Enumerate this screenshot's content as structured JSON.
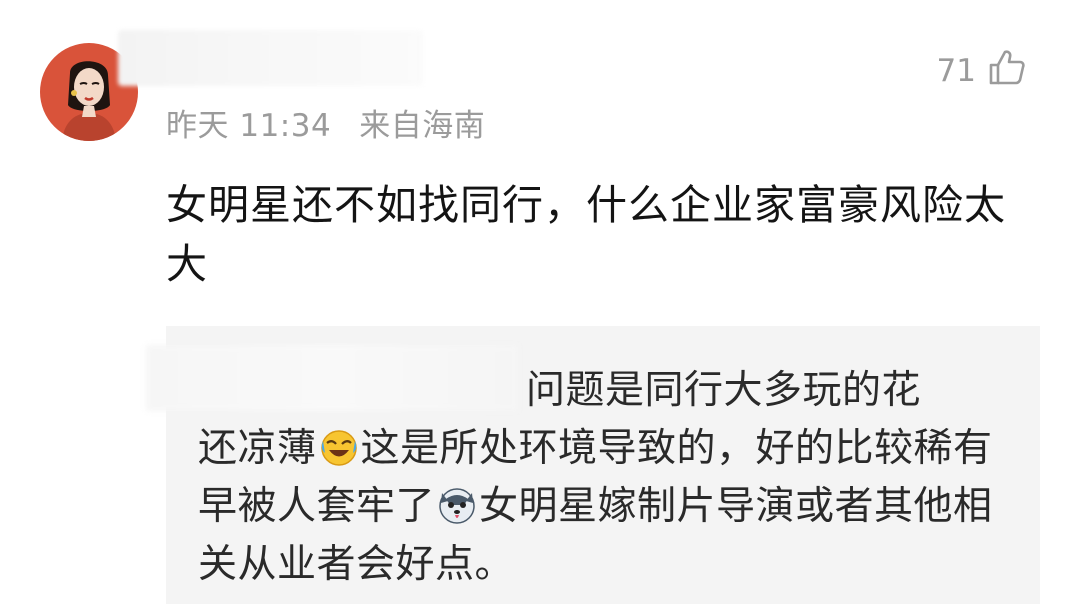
{
  "comment": {
    "time": "昨天 11:34",
    "location": "来自海南",
    "likes": "71",
    "text": "女明星还不如找同行，什么企业家富豪风险太大"
  },
  "reply": {
    "line1": "问题是同行大多玩的花",
    "seg1": "还凉薄",
    "emoji1": "laughing-crying-emoji",
    "seg2": "这是所处环境导致的，好的比较稀有早被人套牢了",
    "emoji2": "husky-dog-emoji",
    "seg3": "女明星嫁制片导演或者其他相关从业者会好点。"
  },
  "colors": {
    "meta": "#9b9b9b",
    "reply_bg": "#f4f4f4",
    "text": "#141414"
  }
}
